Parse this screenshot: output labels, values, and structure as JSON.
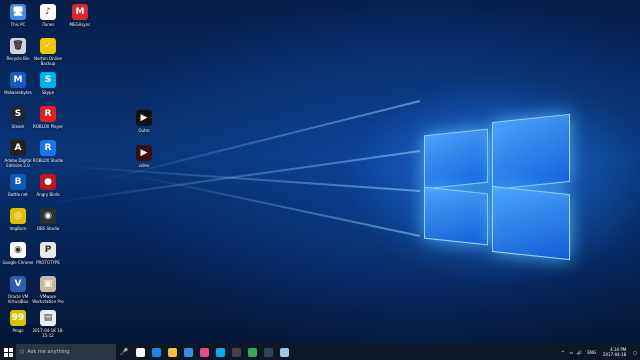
{
  "desktop": {
    "icons": [
      {
        "label": "This PC",
        "color": "#3b8fdc",
        "glyph": "🖥"
      },
      {
        "label": "Recycle Bin",
        "color": "#cfd6de",
        "glyph": "🗑"
      },
      {
        "label": "Malwarebytes",
        "color": "#1b56c9",
        "glyph": "M"
      },
      {
        "label": "Steam",
        "color": "#1b2838",
        "glyph": "S"
      },
      {
        "label": "Adobe Digital Editions 2.0",
        "color": "#222222",
        "glyph": "A"
      },
      {
        "label": "Battle.net",
        "color": "#0a5ab8",
        "glyph": "B"
      },
      {
        "label": "ImgBurn",
        "color": "#e6c000",
        "glyph": "◎"
      },
      {
        "label": "Google Chrome",
        "color": "#ffffff",
        "glyph": "◉"
      },
      {
        "label": "Oracle VM VirtualBox",
        "color": "#2f5fa8",
        "glyph": "V"
      },
      {
        "label": "Progs",
        "color": "#d8c200",
        "glyph": "99"
      },
      {
        "label": "iTunes",
        "color": "#ffffff",
        "glyph": "♪"
      },
      {
        "label": "Norton Online Backup",
        "color": "#f6c400",
        "glyph": "✓"
      },
      {
        "label": "Skype",
        "color": "#00aff0",
        "glyph": "S"
      },
      {
        "label": "ROBLOX Player",
        "color": "#e02020",
        "glyph": "R"
      },
      {
        "label": "ROBLOX Studio",
        "color": "#1a73e8",
        "glyph": "R"
      },
      {
        "label": "Angry Birds",
        "color": "#c01818",
        "glyph": "●"
      },
      {
        "label": "OBS Studio",
        "color": "#303030",
        "glyph": "◉"
      },
      {
        "label": "PROTOTYPE",
        "color": "#e8e8e8",
        "glyph": "P"
      },
      {
        "label": "VMware Workstation Pro",
        "color": "#c7b8a0",
        "glyph": "▣"
      },
      {
        "label": "2017-04-18 18-15-12",
        "color": "#e8eef6",
        "glyph": "▤"
      },
      {
        "label": "MEGAsync",
        "color": "#d9272e",
        "glyph": "M"
      },
      {
        "label": "Outro",
        "color": "#111111",
        "glyph": "▶"
      },
      {
        "label": "video",
        "color": "#3a0f0f",
        "glyph": "▶"
      }
    ]
  },
  "taskbar": {
    "search_placeholder": "Ask me anything",
    "pinned": [
      {
        "name": "task-view",
        "color": "#ffffff"
      },
      {
        "name": "edge",
        "color": "#1e88e5"
      },
      {
        "name": "file-explorer",
        "color": "#f3c13a"
      },
      {
        "name": "store",
        "color": "#3a8be0"
      },
      {
        "name": "itunes",
        "color": "#e84d8a"
      },
      {
        "name": "skype",
        "color": "#00aff0"
      },
      {
        "name": "obs",
        "color": "#444444"
      },
      {
        "name": "chrome",
        "color": "#34a853"
      },
      {
        "name": "steam",
        "color": "#2a475e"
      },
      {
        "name": "file",
        "color": "#9ec7e8"
      }
    ],
    "language": "ENG",
    "time": "4:34 PM",
    "date": "2017-04-18"
  }
}
